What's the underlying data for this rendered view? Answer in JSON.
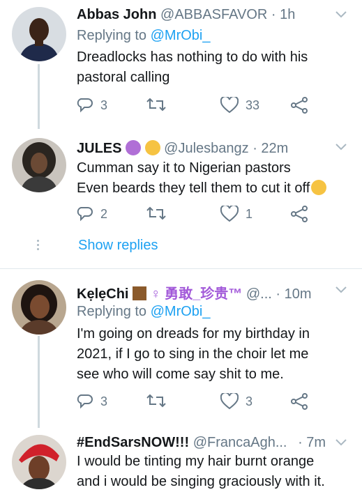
{
  "tweets": [
    {
      "name": "Abbas John",
      "handle": "@ABBASFAVOR",
      "time": "· 1h",
      "replying_label": "Replying to ",
      "replying_to": "@MrObi_",
      "lines": [
        "Dreadlocks has nothing to do with his",
        "pastoral calling"
      ],
      "replies": "3",
      "retweets": "",
      "likes": "33"
    },
    {
      "name": "JULES",
      "handle": "@Julesbangz",
      "time": "· 22m",
      "lines": [
        "Cumman say it to Nigerian pastors",
        "Even beards they tell them to cut it off"
      ],
      "replies": "2",
      "retweets": "",
      "likes": "1"
    },
    {
      "name": "KẹlẹChi",
      "name_suffix": "♀ 勇敢_珍贵™",
      "handle": "@...",
      "time": "· 10m",
      "replying_label": "Replying to ",
      "replying_to": "@MrObi_",
      "lines": [
        "I'm going on dreads for my birthday in",
        "2021, if I go to sing in the choir let me",
        "see who will come say shit to me."
      ],
      "replies": "3",
      "retweets": "",
      "likes": "3"
    },
    {
      "name": "#EndSarsNOW!!!",
      "handle": "@FrancaAgh...",
      "time": "· 7m",
      "lines": [
        "I would be tinting my hair burnt orange",
        "and i would be singing graciously with it."
      ]
    }
  ],
  "show_replies": "Show replies",
  "colors": {
    "accent": "#1da1f2",
    "muted": "#657786",
    "text": "#14171a",
    "divider": "#e1e8ed"
  },
  "icons": [
    "reply-icon",
    "retweet-icon",
    "like-icon",
    "share-icon",
    "chevron-down-icon"
  ]
}
